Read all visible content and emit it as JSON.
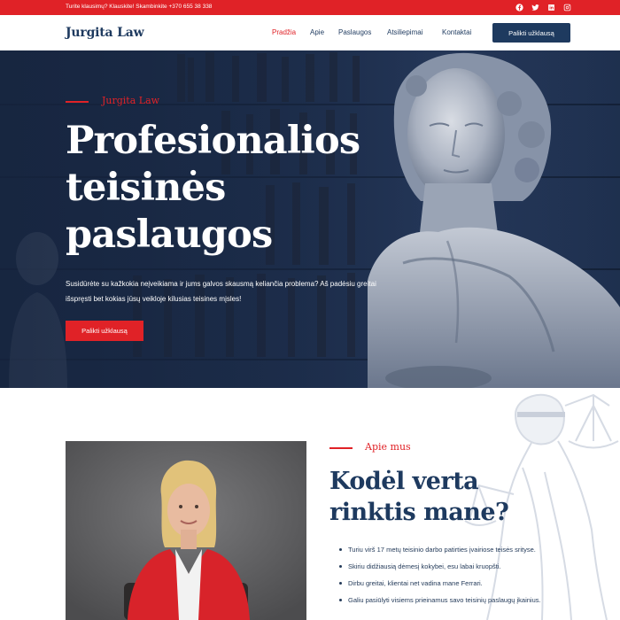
{
  "topbar": {
    "contact_text": "Turite klausimų? Klauskite! Skambinkite +370 655 38 338",
    "social_icons": [
      "facebook-icon",
      "twitter-icon",
      "linkedin-icon",
      "instagram-icon"
    ]
  },
  "header": {
    "logo": "Jurgita Law",
    "nav": [
      "Pradžia",
      "Apie",
      "Paslaugos",
      "Atsiliepimai",
      "Kontaktai"
    ],
    "active_nav": "Pradžia",
    "cta_label": "Palikti užklausą"
  },
  "hero": {
    "eyebrow": "Jurgita Law",
    "title_lines": [
      "Profesionalios",
      "teisinės",
      "paslaugos"
    ],
    "description": "Susidūrėte su kažkokia neįveikiama ir jums galvos skausmą keliančia problema? Aš padėsiu greitai išspręsti bet kokias jūsų veikloje kilusias teisines mįsles!",
    "cta_label": "Palikti užklausą"
  },
  "about": {
    "eyebrow": "Apie mus",
    "title_lines": [
      "Kodėl verta",
      "rinktis mane?"
    ],
    "points": [
      "Turiu virš 17 metų teisinio darbo patirties įvairiose teisės srityse.",
      "Skiriu didžiausią dėmesį kokybei, esu labai kruopšti.",
      "Dirbu greitai, klientai net vadina mane Ferrari.",
      "Galiu pasiūlyti visiems prieinamus savo teisinių paslaugų įkainius."
    ]
  },
  "colors": {
    "accent_red": "#e02227",
    "navy": "#1e3a5f",
    "white": "#ffffff"
  }
}
